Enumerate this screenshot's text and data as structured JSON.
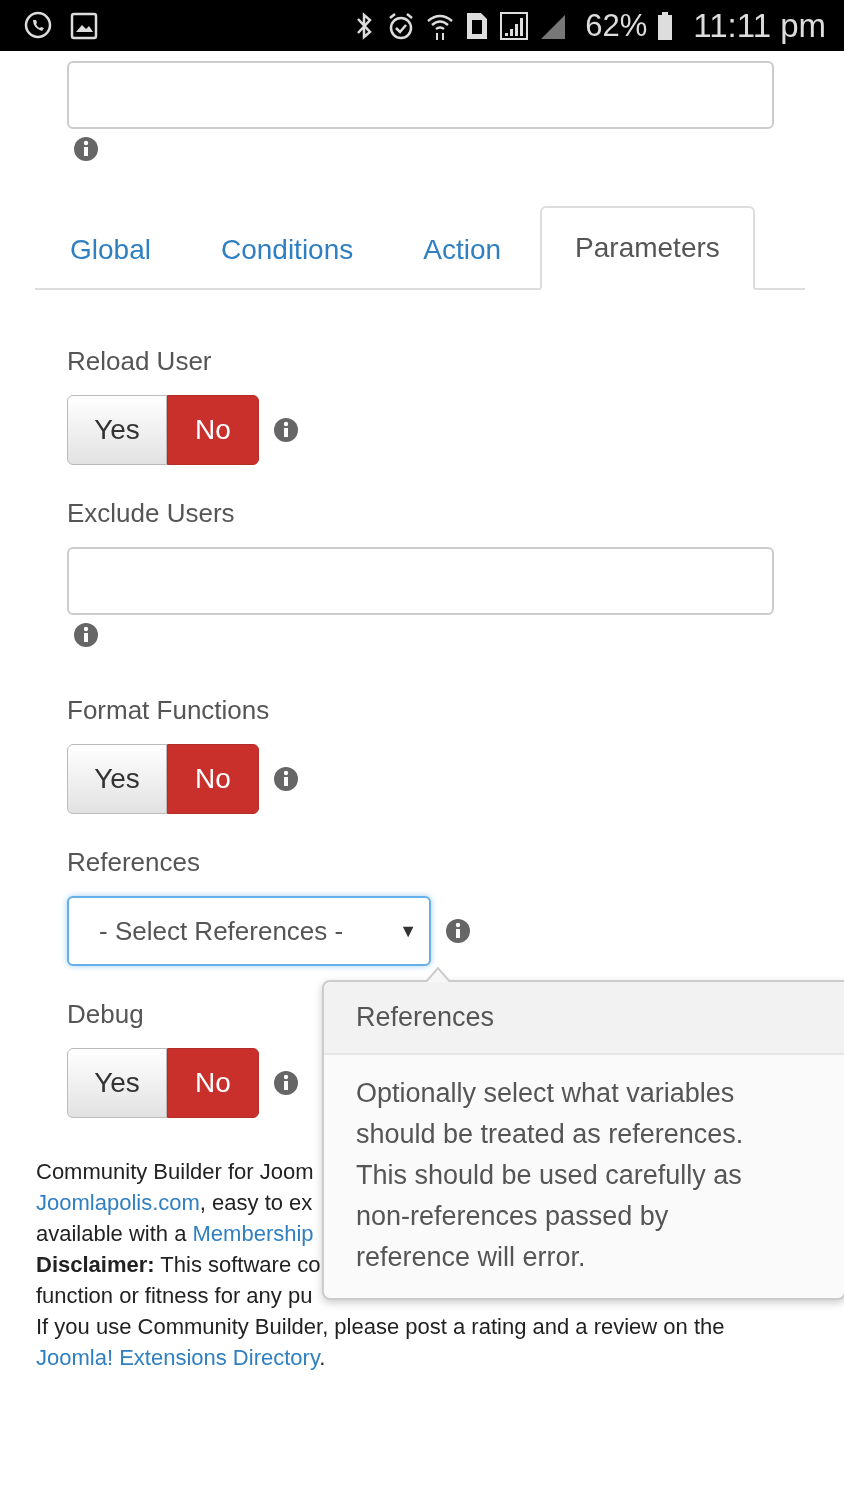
{
  "status_bar": {
    "battery": "62%",
    "time": "11:11 pm"
  },
  "tabs": [
    {
      "label": "Global",
      "selected": false
    },
    {
      "label": "Conditions",
      "selected": false
    },
    {
      "label": "Action",
      "selected": false
    },
    {
      "label": "Parameters",
      "selected": true
    }
  ],
  "fields": [
    {
      "kind": "toggle",
      "label": "Reload User",
      "options": [
        {
          "label": "Yes",
          "selected": false
        },
        {
          "label": "No",
          "selected": true
        }
      ]
    },
    {
      "kind": "text",
      "label": "Exclude Users"
    },
    {
      "kind": "toggle",
      "label": "Format Functions",
      "options": [
        {
          "label": "Yes",
          "selected": false
        },
        {
          "label": "No",
          "selected": true
        }
      ]
    },
    {
      "kind": "select",
      "label": "References",
      "placeholder": "- Select References -",
      "arrow": "▼"
    },
    {
      "kind": "toggle",
      "label": "Debug",
      "options": [
        {
          "label": "Yes",
          "selected": false
        },
        {
          "label": "No",
          "selected": true
        }
      ]
    }
  ],
  "popover": {
    "title": "References",
    "body": "Optionally select what variables should be treated as references. This should be used carefully as non-references passed by reference will error."
  },
  "footer": [
    [
      {
        "kind": "text",
        "text": "Community Builder for Joom"
      }
    ],
    [
      {
        "kind": "link",
        "text": "Joomlapolis.com"
      },
      {
        "kind": "text",
        "text": ", easy to ex"
      }
    ],
    [
      {
        "kind": "text",
        "text": "available with a "
      },
      {
        "kind": "link",
        "text": "Membership"
      }
    ],
    [
      {
        "kind": "bold",
        "text": "Disclaimer:"
      },
      {
        "kind": "text",
        "text": " This software co"
      }
    ],
    [
      {
        "kind": "text",
        "text": "function or fitness for any pu"
      }
    ],
    [
      {
        "kind": "text",
        "text": "If you use Community Builder, please post a rating and a review on the"
      }
    ],
    [
      {
        "kind": "link",
        "text": "Joomla! Extensions Directory"
      },
      {
        "kind": "text",
        "text": "."
      }
    ]
  ]
}
